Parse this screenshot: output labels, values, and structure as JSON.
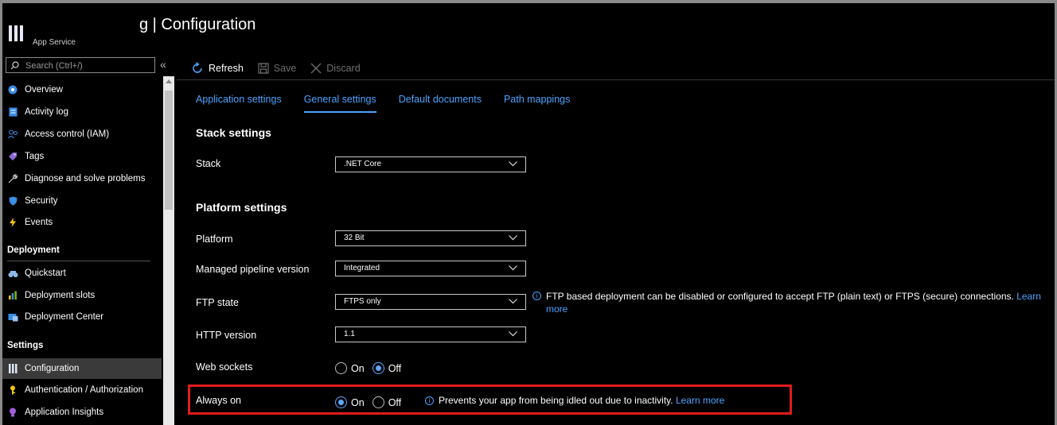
{
  "header": {
    "title": "g | Configuration",
    "subtitle": "App Service"
  },
  "sidebar": {
    "search_placeholder": "Search (Ctrl+/)",
    "collapse_glyph": "«",
    "items": [
      {
        "label": "Overview",
        "icon": "overview-icon"
      },
      {
        "label": "Activity log",
        "icon": "activity-log-icon"
      },
      {
        "label": "Access control (IAM)",
        "icon": "iam-icon"
      },
      {
        "label": "Tags",
        "icon": "tag-icon"
      },
      {
        "label": "Diagnose and solve problems",
        "icon": "wrench-icon"
      },
      {
        "label": "Security",
        "icon": "shield-icon"
      },
      {
        "label": "Events",
        "icon": "lightning-icon"
      }
    ],
    "section_deployment": "Deployment",
    "deployment_items": [
      {
        "label": "Quickstart",
        "icon": "quickstart-icon"
      },
      {
        "label": "Deployment slots",
        "icon": "slots-icon"
      },
      {
        "label": "Deployment Center",
        "icon": "deployment-center-icon"
      }
    ],
    "section_settings": "Settings",
    "settings_items": [
      {
        "label": "Configuration",
        "icon": "configuration-icon",
        "active": true
      },
      {
        "label": "Authentication / Authorization",
        "icon": "key-icon"
      },
      {
        "label": "Application Insights",
        "icon": "lightbulb-icon"
      }
    ]
  },
  "toolbar": {
    "refresh": "Refresh",
    "save": "Save",
    "discard": "Discard"
  },
  "tabs": [
    {
      "label": "Application settings",
      "active": false
    },
    {
      "label": "General settings",
      "active": true
    },
    {
      "label": "Default documents",
      "active": false
    },
    {
      "label": "Path mappings",
      "active": false
    }
  ],
  "stack_settings": {
    "title": "Stack settings",
    "stack_label": "Stack",
    "stack_value": ".NET Core"
  },
  "platform_settings": {
    "title": "Platform settings",
    "platform_label": "Platform",
    "platform_value": "32 Bit",
    "pipeline_label": "Managed pipeline version",
    "pipeline_value": "Integrated",
    "ftp_label": "FTP state",
    "ftp_value": "FTPS only",
    "ftp_info": "FTP based deployment can be disabled or configured to accept FTP (plain text) or FTPS (secure) connections.",
    "ftp_link_1": "Learn",
    "ftp_link_2": "more",
    "http_label": "HTTP version",
    "http_value": "1.1",
    "websockets_label": "Web sockets",
    "websockets_on": "On",
    "websockets_off": "Off",
    "websockets_selected": "Off",
    "alwayson_label": "Always on",
    "alwayson_on": "On",
    "alwayson_off": "Off",
    "alwayson_selected": "On",
    "alwayson_info": "Prevents your app from being idled out due to inactivity.",
    "alwayson_link": "Learn more"
  },
  "colors": {
    "accent": "#4aa3ff",
    "highlight_box": "#e01c1c",
    "background": "#000000"
  }
}
